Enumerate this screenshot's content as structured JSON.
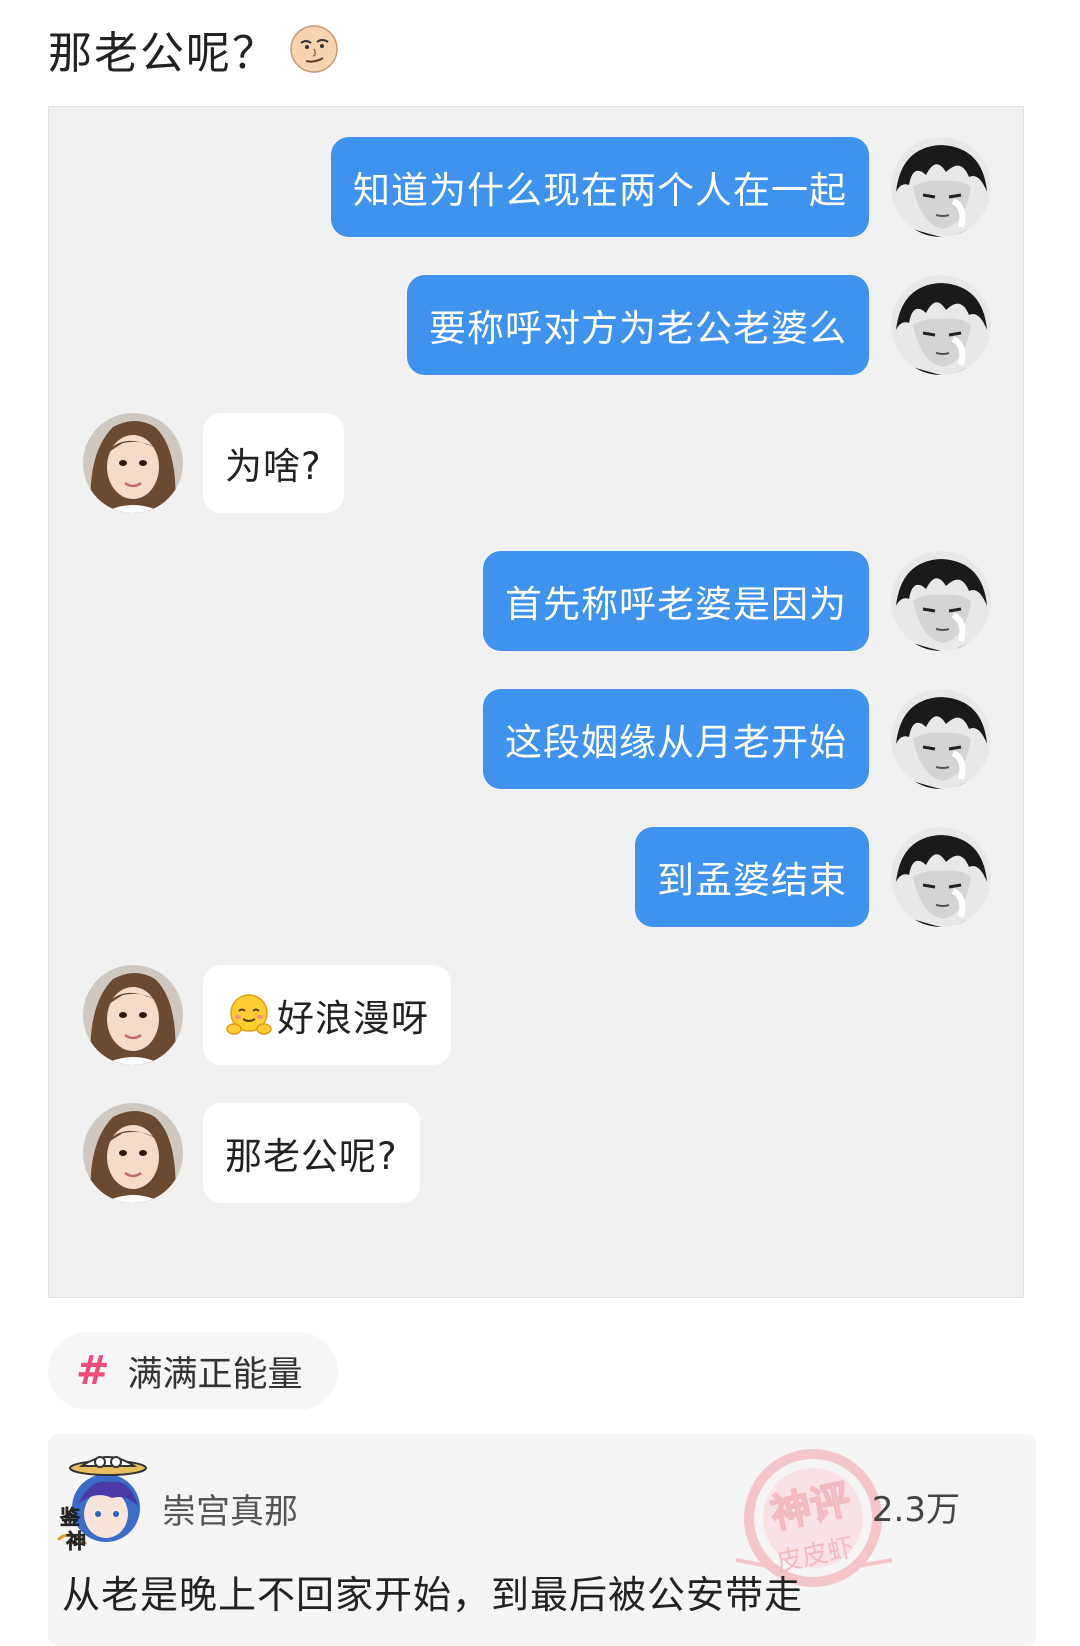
{
  "post": {
    "title": "那老公呢？"
  },
  "chat": {
    "messages": [
      {
        "side": "right",
        "text": "知道为什么现在两个人在一起"
      },
      {
        "side": "right",
        "text": "要称呼对方为老公老婆么"
      },
      {
        "side": "left",
        "text": "为啥?"
      },
      {
        "side": "right",
        "text": "首先称呼老婆是因为"
      },
      {
        "side": "right",
        "text": "这段姻缘从月老开始"
      },
      {
        "side": "right",
        "text": "到孟婆结束"
      },
      {
        "side": "left",
        "text": "好浪漫呀",
        "emoji": "hug-emoji-icon"
      },
      {
        "side": "left",
        "text": "那老公呢?"
      }
    ],
    "colors": {
      "right_bubble": "#3f93ee",
      "left_bubble": "#ffffff",
      "panel_background": "#f1f1f1"
    }
  },
  "tag": {
    "symbol": "#",
    "label": "满满正能量",
    "color": "#ef4b7a"
  },
  "comment": {
    "username": "崇宫真那",
    "likes": "2.3万",
    "text": "从老是晚上不回家开始，到最后被公安带走",
    "badge_text": "鉴神"
  },
  "watermark": {
    "line1": "神评",
    "line2": "皮皮虾"
  }
}
